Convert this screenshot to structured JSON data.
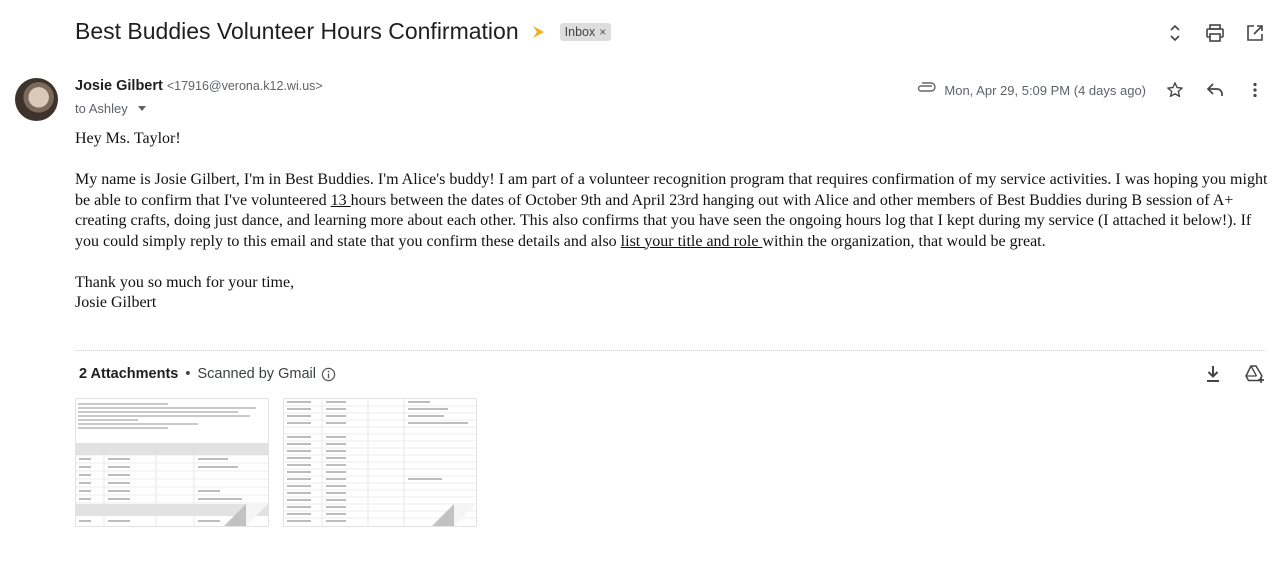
{
  "header": {
    "subject": "Best Buddies Volunteer Hours Confirmation",
    "label": "Inbox",
    "label_close": "×",
    "icons": [
      "expand-collapse-icon",
      "print-icon",
      "open-in-new-window-icon"
    ]
  },
  "message": {
    "sender_name": "Josie Gilbert",
    "sender_email": "<17916@verona.k12.wi.us>",
    "to_text": "to Ashley",
    "date": "Mon, Apr 29, 5:09 PM (4 days ago)",
    "icons": [
      "attachment-clip-icon",
      "star-icon",
      "reply-icon",
      "more-vert-icon"
    ],
    "greeting": "Hey Ms. Taylor!",
    "body_before_13": "My name is Josie Gilbert, I'm in Best Buddies. I'm Alice's buddy! I am part of a volunteer recognition program that requires confirmation of my service activities. I was hoping you might be able to confirm that I've volunteered ",
    "hours_underlined": "13 ",
    "body_after_13": "hours between the dates of October 9th and April 23rd hanging out with Alice and other members of Best Buddies during B session of A+ creating crafts, doing just dance, and learning more about each other. This also confirms that you have seen the ongoing hours log that I kept during my service (I attached it below!). If you could simply reply to this email and state that you confirm these details and also ",
    "title_role_underlined": "list your title and role ",
    "body_end": "within the organization, that would be great.",
    "closing": "Thank you so much for your time,",
    "signature": "Josie Gilbert"
  },
  "attachments": {
    "count_label": "2 Attachments",
    "separator": "•",
    "scan_label": "Scanned by Gmail",
    "icons": [
      "info-icon",
      "download-all-icon",
      "add-to-drive-icon"
    ],
    "thumbnails": [
      "attachment-thumbnail-1",
      "attachment-thumbnail-2"
    ]
  },
  "colors": {
    "important_marker": "#f2b01e",
    "label_chip_bg": "#dddddd",
    "secondary_text": "#5f6368"
  }
}
